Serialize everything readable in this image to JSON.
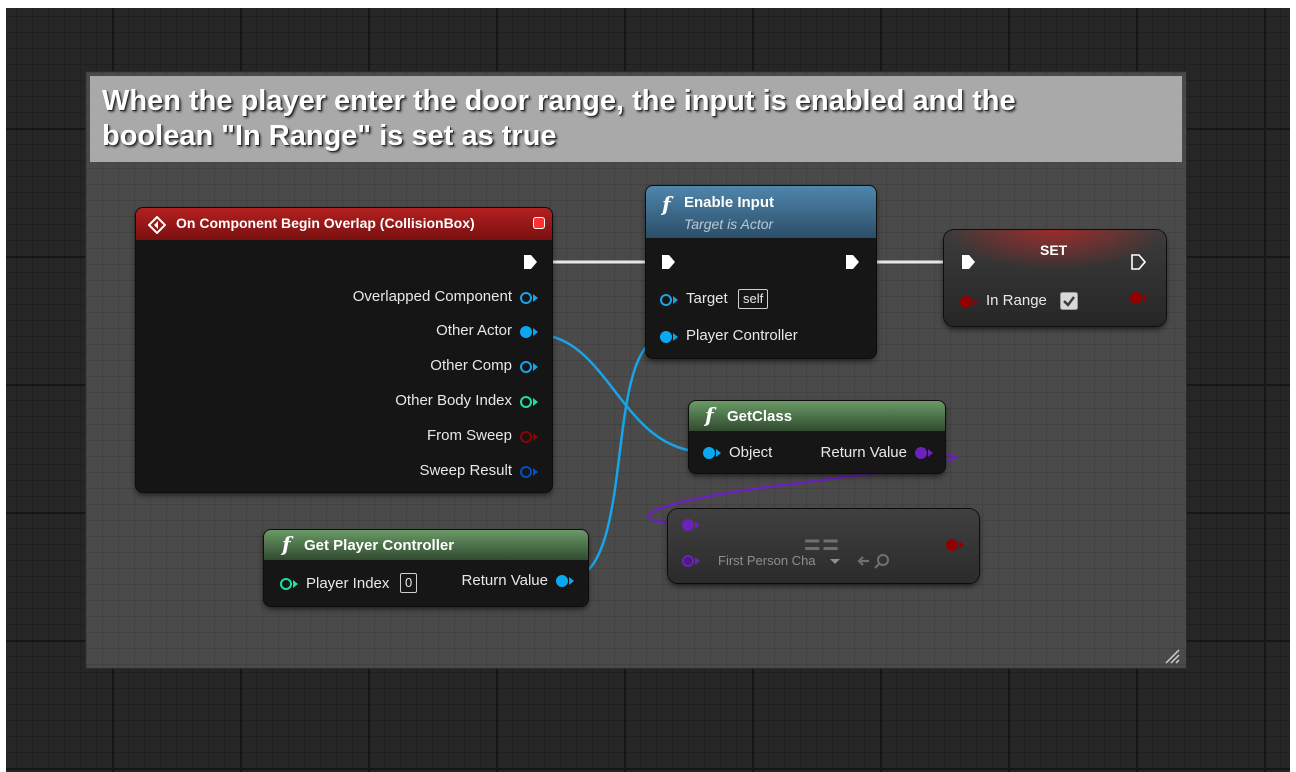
{
  "comment": {
    "title": "When the player enter the door range, the input is enabled and the boolean \"In Range\" is set as true"
  },
  "nodes": {
    "overlap": {
      "title": "On Component Begin Overlap (CollisionBox)",
      "pins": [
        "Overlapped Component",
        "Other Actor",
        "Other Comp",
        "Other Body Index",
        "From Sweep",
        "Sweep Result"
      ]
    },
    "enable_input": {
      "title": "Enable Input",
      "subtitle": "Target is Actor",
      "target_label": "Target",
      "target_value": "self",
      "controller_label": "Player Controller"
    },
    "set": {
      "title": "SET",
      "var_label": "In Range"
    },
    "get_class": {
      "title": "GetClass",
      "object_label": "Object",
      "return_label": "Return Value"
    },
    "get_player_controller": {
      "title": "Get Player Controller",
      "index_label": "Player Index",
      "index_value": "0",
      "return_label": "Return Value"
    },
    "equal": {
      "symbol": "==",
      "class_value": "First Person Cha"
    }
  },
  "colors": {
    "event_header": "#8a1515",
    "function_header": "#3b6a8c",
    "pure_header": "#4f7a4f",
    "object_pin": "#0aa8f0",
    "int_pin": "#1fe0a0",
    "bool_pin": "#930000",
    "struct_pin": "#0050c8",
    "class_pin": "#6a22b8"
  }
}
